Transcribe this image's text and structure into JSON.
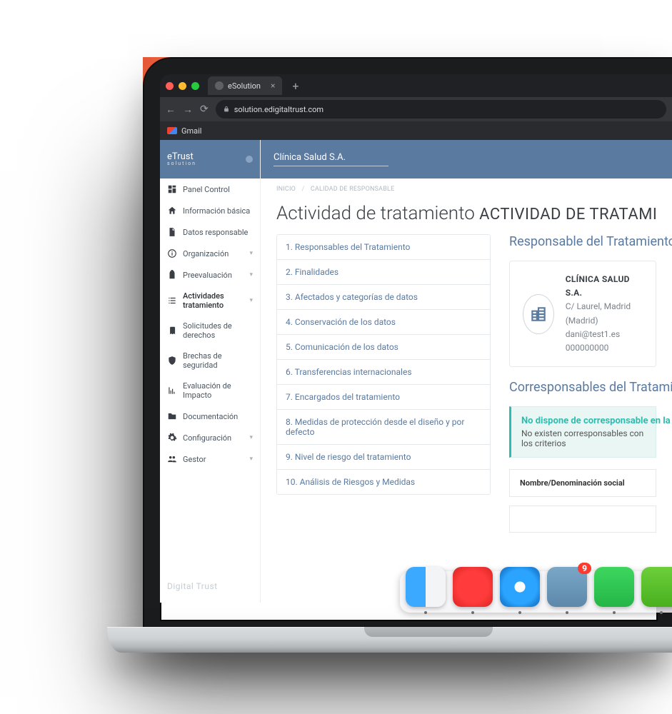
{
  "browser": {
    "tab_title": "eSolution",
    "url": "solution.edigitaltrust.com",
    "bookmark": "Gmail"
  },
  "brand": {
    "name": "eTrust",
    "sub": "solution",
    "footer": "Digital Trust"
  },
  "company": "Clínica Salud S.A.",
  "breadcrumbs": {
    "root": "INICIO",
    "current": "CALIDAD DE RESPONSABLE"
  },
  "page_title": {
    "main": "Actividad de tratamiento",
    "sub": "ACTIVIDAD DE TRATAMI"
  },
  "sidebar": {
    "items": [
      {
        "label": "Panel Control",
        "icon": "dashboard",
        "exp": false
      },
      {
        "label": "Información básica",
        "icon": "home",
        "exp": false
      },
      {
        "label": "Datos responsable",
        "icon": "file",
        "exp": false
      },
      {
        "label": "Organización",
        "icon": "info",
        "exp": true
      },
      {
        "label": "Preevaluación",
        "icon": "clipboard",
        "exp": true
      },
      {
        "label": "Actividades tratamiento",
        "icon": "list",
        "exp": true,
        "active": true
      },
      {
        "label": "Solicitudes de derechos",
        "icon": "book",
        "exp": false
      },
      {
        "label": "Brechas de seguridad",
        "icon": "shield",
        "exp": false
      },
      {
        "label": "Evaluación de Impacto",
        "icon": "chart",
        "exp": false
      },
      {
        "label": "Documentación",
        "icon": "folder",
        "exp": false
      },
      {
        "label": "Configuración",
        "icon": "gear",
        "exp": true
      },
      {
        "label": "Gestor",
        "icon": "people",
        "exp": true
      }
    ]
  },
  "accordion": [
    "1. Responsables del Tratamiento",
    "2. Finalidades",
    "3. Afectados y categorías de datos",
    "4. Conservación de los datos",
    "5. Comunicación de los datos",
    "6. Transferencias internacionales",
    "7. Encargados del tratamiento",
    "8. Medidas de protección desde el diseño y por defecto",
    "9. Nivel de riesgo del tratamiento",
    "10. Análisis de Riesgos y Medidas"
  ],
  "right": {
    "heading1": "Responsable del Tratamiento",
    "card": {
      "name": "CLÍNICA SALUD S.A.",
      "addr": "C/ Laurel, Madrid (Madrid)",
      "email": "dani@test1.es",
      "phone": "000000000"
    },
    "heading2": "Corresponsables del Tratamiento",
    "alert_title": "No dispone de corresponsable en la",
    "alert_body": "No existen corresponsables con los criterios",
    "table_col": "Nombre/Denominación social"
  },
  "dock": {
    "mail_badge": "9"
  }
}
